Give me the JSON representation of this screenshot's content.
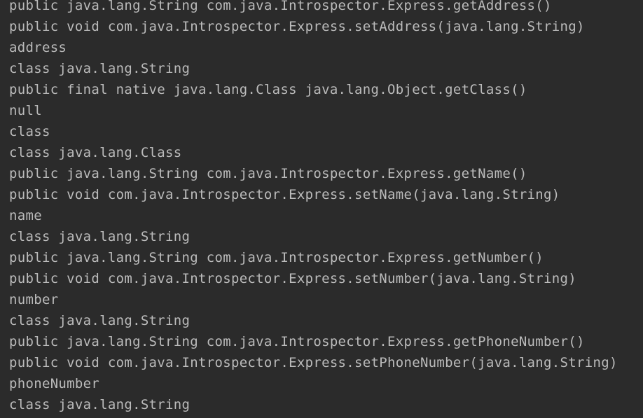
{
  "console": {
    "lines": [
      "public java.lang.String com.java.Introspector.Express.getAddress()",
      "public void com.java.Introspector.Express.setAddress(java.lang.String)",
      "address",
      "class java.lang.String",
      "public final native java.lang.Class java.lang.Object.getClass()",
      "null",
      "class",
      "class java.lang.Class",
      "public java.lang.String com.java.Introspector.Express.getName()",
      "public void com.java.Introspector.Express.setName(java.lang.String)",
      "name",
      "class java.lang.String",
      "public java.lang.String com.java.Introspector.Express.getNumber()",
      "public void com.java.Introspector.Express.setNumber(java.lang.String)",
      "number",
      "class java.lang.String",
      "public java.lang.String com.java.Introspector.Express.getPhoneNumber()",
      "public void com.java.Introspector.Express.setPhoneNumber(java.lang.String)",
      "phoneNumber",
      "class java.lang.String"
    ]
  },
  "colors": {
    "background": "#2b2b2b",
    "text": "#bbbbbb"
  }
}
